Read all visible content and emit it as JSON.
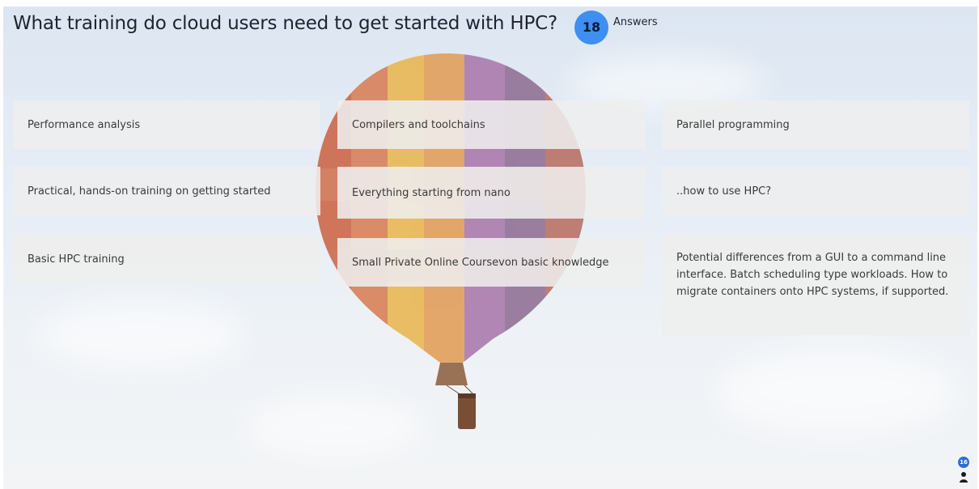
{
  "question": {
    "title": "What training do cloud users need to get started with HPC?",
    "answer_count": "18",
    "answer_label": "Answers"
  },
  "answers": [
    "Performance analysis",
    "Compilers and toolchains",
    "Parallel programming",
    "Practical, hands-on training on getting started",
    "Everything starting from nano",
    "..how to use HPC?",
    "Basic HPC training",
    "Small Private Online Coursevon basic knowledge",
    "Potential differences from a GUI to a command line interface. Batch scheduling type workloads. How to migrate containers onto HPC systems, if supported."
  ],
  "participants": {
    "count": "16",
    "icon": "person-icon"
  },
  "background": {
    "image": "hot-air-balloon-icon",
    "colors": {
      "sky": "#dce6f2",
      "badge": "#3f8ef2",
      "card": "#eeeeee"
    }
  }
}
